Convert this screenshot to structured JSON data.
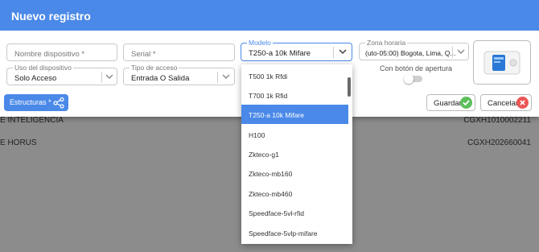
{
  "background_rows": [
    {
      "left": "E INTELIGENCIA",
      "right": "CGXH1010002211"
    },
    {
      "left": "E HORUS",
      "right": "CGXH202660041"
    }
  ],
  "dialog": {
    "title": "Nuevo registro",
    "fields": {
      "device_name": {
        "placeholder": "Nombre dispositivo *"
      },
      "serial": {
        "placeholder": "Serial *"
      },
      "model": {
        "label": "Modelo",
        "value": "T250-a 10k Mifare"
      },
      "timezone": {
        "label": "Zona horaria",
        "value": "(uto-05:00) Bogota, Lima, Q..."
      },
      "device_use": {
        "label": "Uso del dispositivo",
        "value": "Solo Acceso"
      },
      "access_type": {
        "label": "Tipo de acceso",
        "value": "Entrada O Salida"
      }
    },
    "toggle": {
      "label": "Con botón de apertura",
      "on": false
    },
    "structures_label": "Estructuras *",
    "save_label": "Guardar",
    "cancel_label": "Cancelar"
  },
  "model_dropdown": {
    "options": [
      "T500 1k Rfdi",
      "T700 1k Rfid",
      "T250-a 10k Mifare",
      "H100",
      "Zkteco-g1",
      "Zkteco-mb160",
      "Zkteco-mb460",
      "Speedface-5vl-rfid",
      "Speedface-5vlp-mifare"
    ],
    "selected_index": 2
  },
  "colors": {
    "primary": "#4a89e8",
    "save": "#5cbf5c",
    "cancel": "#ee5555"
  }
}
